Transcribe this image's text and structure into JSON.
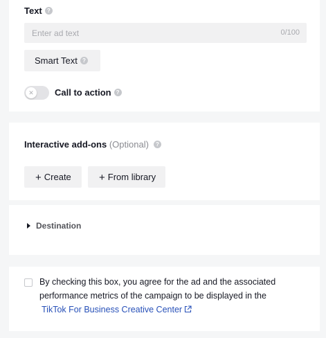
{
  "text_section": {
    "label": "Text",
    "input_placeholder": "Enter ad text",
    "input_value": "",
    "char_counter": "0/100",
    "smart_text_label": "Smart Text",
    "cta_label": "Call to action",
    "cta_enabled": false
  },
  "addons_section": {
    "title": "Interactive add-ons",
    "optional_tag": "(Optional)",
    "create_label": "Create",
    "from_library_label": "From library"
  },
  "destination_section": {
    "label": "Destination",
    "expanded": false
  },
  "consent_section": {
    "checked": false,
    "text": "By checking this box, you agree for the ad and the associated performance metrics of the campaign to be displayed in the",
    "link_text": "TikTok For Business Creative Center"
  },
  "colors": {
    "background": "#f5f6f7",
    "card": "#ffffff",
    "input_fill": "#f1f1f2",
    "link": "#2750b8"
  }
}
